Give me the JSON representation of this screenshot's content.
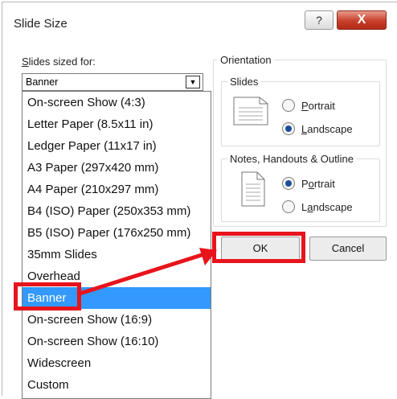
{
  "dialog": {
    "title": "Slide Size",
    "help_glyph": "?",
    "close_glyph": "X",
    "icons": [
      "help-icon",
      "close-icon",
      "chevron-down-icon",
      "landscape-page-icon",
      "portrait-page-icon"
    ]
  },
  "slides_sized_for": {
    "label_accel": "S",
    "label_rest": "lides sized for:",
    "selected": "Banner",
    "options": [
      "On-screen Show (4:3)",
      "Letter Paper (8.5x11 in)",
      "Ledger Paper (11x17 in)",
      "A3 Paper (297x420 mm)",
      "A4 Paper (210x297 mm)",
      "B4 (ISO) Paper (250x353 mm)",
      "B5 (ISO) Paper (176x250 mm)",
      "35mm Slides",
      "Overhead",
      "Banner",
      "On-screen Show (16:9)",
      "On-screen Show (16:10)",
      "Widescreen",
      "Custom"
    ]
  },
  "orientation": {
    "label": "Orientation",
    "slides": {
      "label": "Slides",
      "portrait": {
        "accel": "P",
        "rest": "ortrait",
        "checked": false
      },
      "landscape": {
        "accel": "L",
        "rest": "andscape",
        "checked": true
      }
    },
    "notes": {
      "label": "Notes, Handouts & Outline",
      "portrait": {
        "pre": "P",
        "accel": "o",
        "rest": "rtrait",
        "checked": true
      },
      "landscape": {
        "pre": "L",
        "accel": "a",
        "rest": "ndscape",
        "checked": false
      }
    }
  },
  "buttons": {
    "ok": "OK",
    "cancel": "Cancel"
  },
  "annotation": {
    "color": "#e8141c"
  },
  "colors": {
    "selection": "#3399ff",
    "close": "#c7402b"
  }
}
